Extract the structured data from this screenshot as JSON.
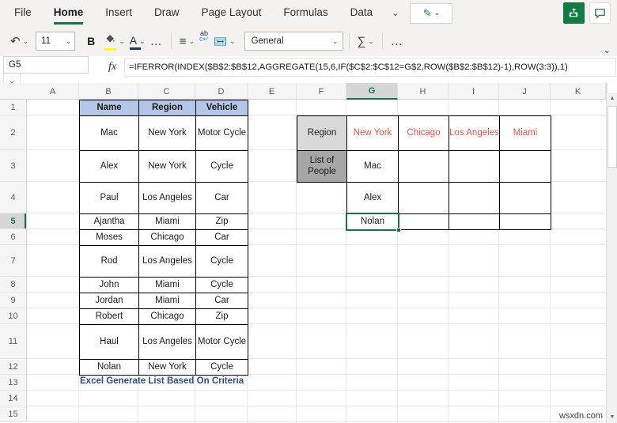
{
  "ribbon": {
    "tabs": [
      {
        "label": "File",
        "active": false
      },
      {
        "label": "Home",
        "active": true
      },
      {
        "label": "Insert",
        "active": false
      },
      {
        "label": "Draw",
        "active": false
      },
      {
        "label": "Page Layout",
        "active": false
      },
      {
        "label": "Formulas",
        "active": false
      },
      {
        "label": "Data",
        "active": false
      }
    ],
    "overflow_chevron": "⌄",
    "pen_icon": "✎",
    "pen_chevron": "⌄",
    "share_icon": "share-icon",
    "comment_icon": "comment-icon"
  },
  "toolbar": {
    "undo_icon": "↶",
    "undo_chevron": "⌄",
    "font_size": "11",
    "font_size_chevron": "⌄",
    "bold_label": "B",
    "fill_color_icon": "✐",
    "fill_color_chevron": "⌄",
    "font_color_label": "A",
    "font_color_chevron": "⌄",
    "more_font_icon": "…",
    "align_icon": "≡",
    "align_chevron": "⌄",
    "wrap_text_icon": "ab",
    "merge_icon": "↔",
    "merge_chevron": "⌄",
    "number_format": "General",
    "number_format_chevron": "⌄",
    "autosum_icon": "∑",
    "autosum_chevron": "⌄",
    "more_icon": "…",
    "collapse_chevron": "⌄"
  },
  "formula_bar": {
    "name_box_value": "G5",
    "name_box_chevron": "⌄",
    "fx_label": "fx",
    "formula": "=IFERROR(INDEX($B$2:$B$12,AGGREGATE(15,6,IF($C$2:$C$12=G$2,ROW($B$2:$B$12)-1),ROW(3:3)),1)"
  },
  "grid": {
    "columns": [
      "A",
      "B",
      "C",
      "D",
      "E",
      "F",
      "G",
      "H",
      "I",
      "J",
      "K"
    ],
    "selected_column": "G",
    "rows": [
      "1",
      "2",
      "3",
      "4",
      "5",
      "6",
      "7",
      "8",
      "9",
      "10",
      "11",
      "12",
      "13",
      "14",
      "15"
    ],
    "selected_row": "5",
    "selected_cell": "G5"
  },
  "source_table": {
    "headers": [
      "Name",
      "Region",
      "Vehicle"
    ],
    "rows": [
      {
        "name": "Mac",
        "region": "New York",
        "vehicle": "Motor Cycle"
      },
      {
        "name": "Alex",
        "region": "New York",
        "vehicle": "Cycle"
      },
      {
        "name": "Paul",
        "region": "Los Angeles",
        "vehicle": "Car"
      },
      {
        "name": "Ajantha",
        "region": "Miami",
        "vehicle": "Zip"
      },
      {
        "name": "Moses",
        "region": "Chicago",
        "vehicle": "Car"
      },
      {
        "name": "Rod",
        "region": "Los Angeles",
        "vehicle": "Cycle"
      },
      {
        "name": "John",
        "region": "Miami",
        "vehicle": "Cycle"
      },
      {
        "name": "Jordan",
        "region": "Miami",
        "vehicle": "Car"
      },
      {
        "name": "Robert",
        "region": "Chicago",
        "vehicle": "Zip"
      },
      {
        "name": "Haul",
        "region": "Los Angeles",
        "vehicle": "Motor Cycle"
      },
      {
        "name": "Nolan",
        "region": "New York",
        "vehicle": "Cycle"
      }
    ]
  },
  "result_table": {
    "row_label_top": "Region",
    "row_label_bottom": "List of People",
    "region_headers": [
      "New York",
      "Chicago",
      "Los Angeles",
      "Miami"
    ],
    "result_rows": [
      [
        "Mac",
        "",
        "",
        ""
      ],
      [
        "Alex",
        "",
        "",
        ""
      ],
      [
        "Nolan",
        "",
        "",
        ""
      ]
    ]
  },
  "caption": "Excel Generate List Based On Criteria",
  "watermark": "wsxdn.com",
  "colors": {
    "accent_green": "#107c41",
    "header_blue": "#b4c6e7",
    "light_gray": "#d9d9d9",
    "dark_gray": "#a6a6a6",
    "region_red": "#e8534a",
    "caption_blue": "#2e4b8f"
  }
}
